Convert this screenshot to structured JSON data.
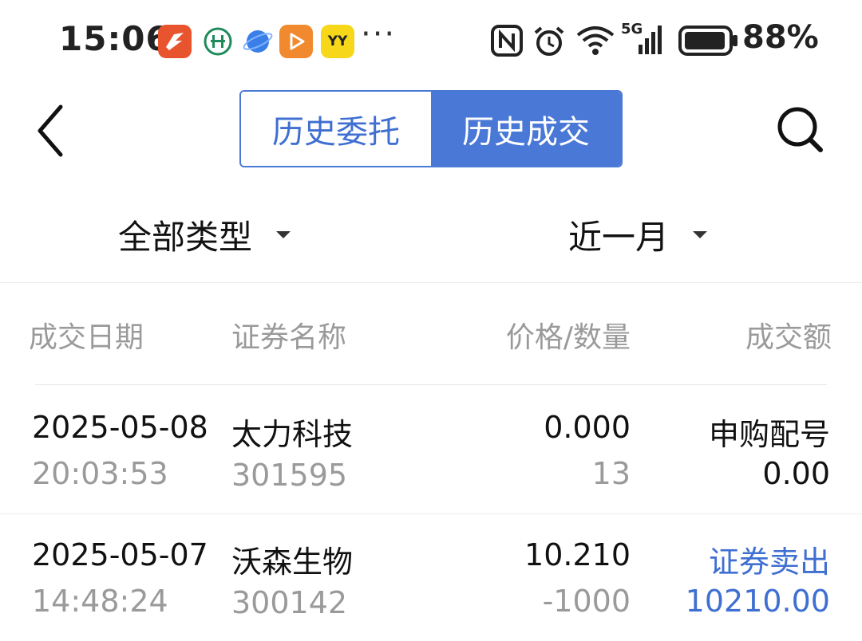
{
  "status_bar": {
    "time": "15:06",
    "apps": [
      {
        "icon": "red-bird-app-icon",
        "color": "#e8542d",
        "label": ""
      },
      {
        "icon": "bank-logo-icon",
        "color": "#ffffff",
        "label": ""
      },
      {
        "icon": "blue-planet-app-icon",
        "color": "#3a7ee8",
        "label": ""
      },
      {
        "icon": "orange-play-app-icon",
        "color": "#f18a2e",
        "label": ""
      },
      {
        "icon": "yy-app-icon",
        "color": "#f7d71a",
        "label": "YY"
      }
    ],
    "more": "···",
    "icons": [
      "nfc-icon",
      "alarm-icon",
      "wifi-icon",
      "5g-signal-icon",
      "battery-icon"
    ],
    "network_label": "5G",
    "battery_percent": "88%"
  },
  "header": {
    "tabs": [
      {
        "label": "历史委托",
        "active": false
      },
      {
        "label": "历史成交",
        "active": true
      }
    ],
    "accent_color": "#4a78d6"
  },
  "filters": {
    "type": "全部类型",
    "period": "近一月"
  },
  "table": {
    "columns": [
      "成交日期",
      "证券名称",
      "价格/数量",
      "成交额"
    ],
    "rows": [
      {
        "date": "2025-05-08",
        "time": "20:03:53",
        "name": "太力科技",
        "code": "301595",
        "price": "0.000",
        "quantity": "13",
        "action": "申购配号",
        "amount": "0.00",
        "highlight": false
      },
      {
        "date": "2025-05-07",
        "time": "14:48:24",
        "name": "沃森生物",
        "code": "300142",
        "price": "10.210",
        "quantity": "-1000",
        "action": "证券卖出",
        "amount": "10210.00",
        "highlight": true
      }
    ]
  }
}
